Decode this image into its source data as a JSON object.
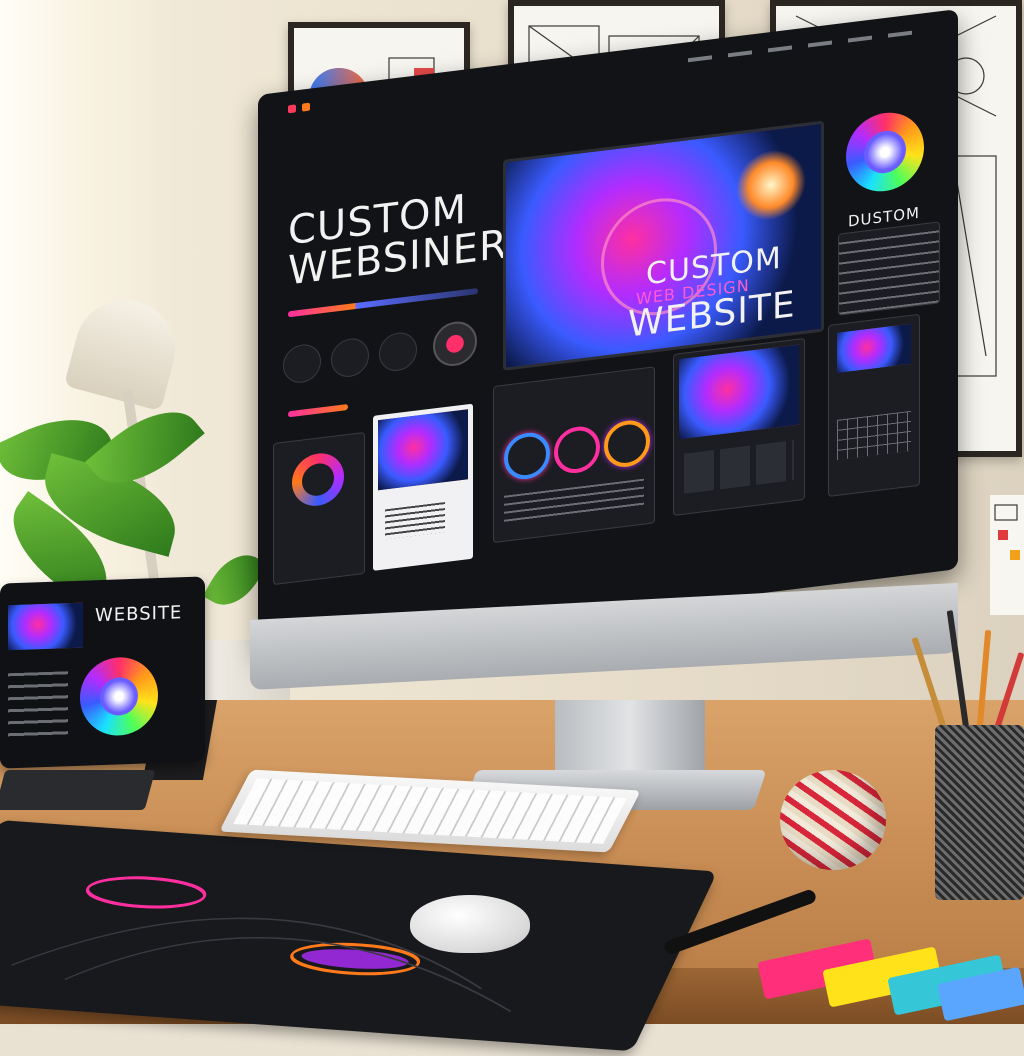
{
  "monitor": {
    "brand_title": "CUSTOM WEBSINER",
    "hero_line1": "CUSTOM",
    "hero_line2": "WEB DESIGN",
    "hero_line3": "WEBSITE",
    "side_label": "DUSTOM"
  },
  "tablet": {
    "title": "WEBSITE"
  },
  "colors": {
    "accent_pink": "#ff2fa0",
    "accent_purple": "#b22cff",
    "accent_blue": "#3a5bff",
    "accent_orange": "#ff7a1a",
    "screen_bg": "#121316"
  },
  "icons": {
    "color_wheel": "color-wheel-icon",
    "palette": "palette-icon"
  }
}
